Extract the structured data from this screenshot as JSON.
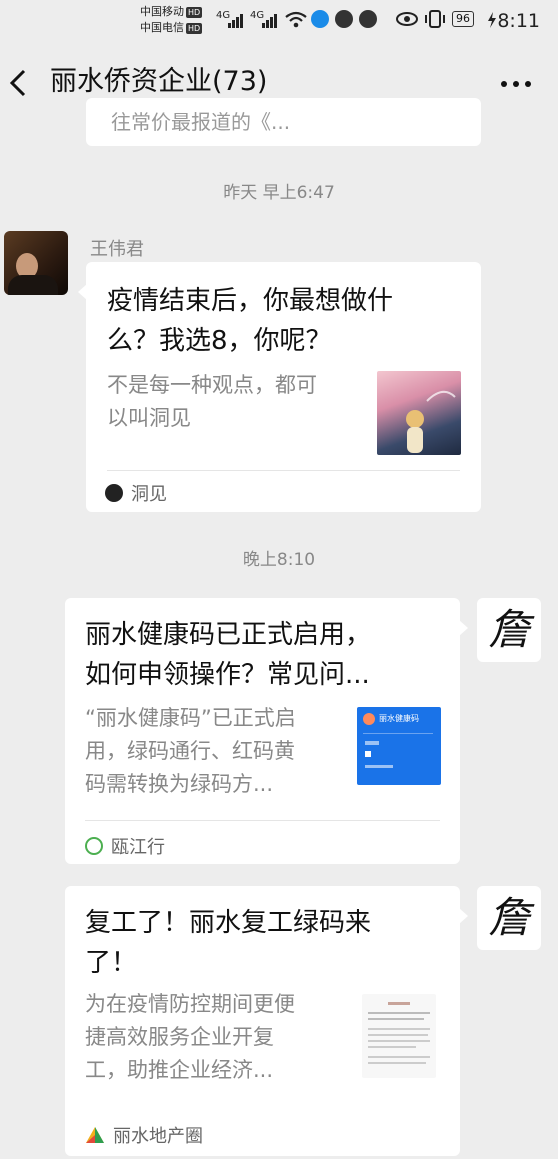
{
  "status_bar": {
    "carrier1": "中国移动",
    "carrier2": "中国电信",
    "hd": "HD",
    "net1": "4G",
    "net2": "4G",
    "battery": "96",
    "time": "8:11"
  },
  "nav": {
    "title": "丽水侨资企业(73)",
    "back": "‹",
    "more": "···"
  },
  "partial_card_text": "往常价最报道的《...",
  "time_separators": [
    "昨天 早上6:47",
    "晚上8:10"
  ],
  "messages": [
    {
      "sender": "王伟君",
      "title": "疫情结束后，你最想做什么？我选8，你呢？",
      "title_line1": "疫情结束后，你最想做什",
      "title_line2": "么？我选8，你呢？",
      "desc_line1": "不是每一种观点，都可",
      "desc_line2": "以叫洞见",
      "source": "洞见"
    },
    {
      "title_line1": "丽水健康码已正式启用，",
      "title_line2": "如何申领操作？常见问...",
      "desc_line1": "“丽水健康码”已正式启",
      "desc_line2": "用，绿码通行、红码黄",
      "desc_line3": "码需转换为绿码方...",
      "source": "瓯江行",
      "thumb_label": "丽水健康码"
    },
    {
      "title_line1": "复工了！丽水复工绿码来",
      "title_line2": "了！",
      "desc_line1": "为在疫情防控期间更便",
      "desc_line2": "捷高效服务企业开复",
      "desc_line3": "工，助推企业经济...",
      "source": "丽水地产圈"
    }
  ],
  "avatar_right_glyph": "詹",
  "colors": {
    "background": "#ededed",
    "card": "#ffffff",
    "secondary_text": "#888888"
  }
}
